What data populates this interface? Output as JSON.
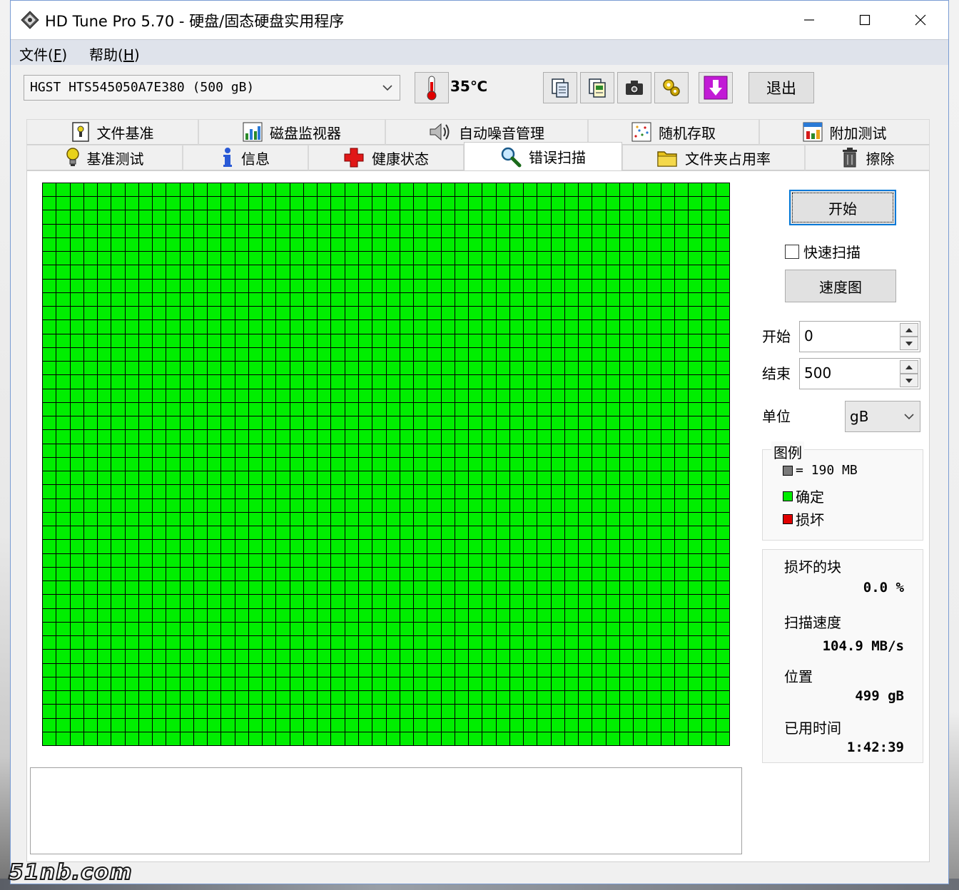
{
  "window": {
    "title": "HD Tune Pro 5.70 - 硬盘/固态硬盘实用程序"
  },
  "menu": {
    "file": "文件",
    "file_key": "F",
    "help": "帮助",
    "help_key": "H"
  },
  "toolbar": {
    "drive": "HGST HTS545050A7E380 (500 gB)",
    "temperature": "35℃",
    "exit_label": "退出",
    "icons": [
      "copy-icon",
      "copy-all-icon",
      "camera-icon",
      "options-icon",
      "download-icon"
    ]
  },
  "tabs": {
    "row1": [
      "文件基准",
      "磁盘监视器",
      "自动噪音管理",
      "随机存取",
      "附加测试"
    ],
    "row2": [
      "基准测试",
      "信息",
      "健康状态",
      "错误扫描",
      "文件夹占用率",
      "擦除"
    ],
    "active": "错误扫描"
  },
  "scan": {
    "grid_cols": 50,
    "grid_rows": 41,
    "ok_color": "#00ee00",
    "bad_color": "#e00000",
    "block_color": "#7a7a7a"
  },
  "controls": {
    "start_button": "开始",
    "quick_scan_label": "快速扫描",
    "quick_scan_checked": false,
    "speed_map_button": "速度图",
    "start_label": "开始",
    "start_value": "0",
    "end_label": "结束",
    "end_value": "500",
    "unit_label": "单位",
    "unit_value": "gB"
  },
  "legend": {
    "title": "图例",
    "block_size": "= 190 MB",
    "ok": "确定",
    "bad": "损坏"
  },
  "stats": {
    "damaged_label": "损坏的块",
    "damaged_value": "0.0 %",
    "speed_label": "扫描速度",
    "speed_value": "104.9 MB/s",
    "position_label": "位置",
    "position_value": "499 gB",
    "elapsed_label": "已用时间",
    "elapsed_value": "1:42:39"
  },
  "watermark": "51nb.com"
}
